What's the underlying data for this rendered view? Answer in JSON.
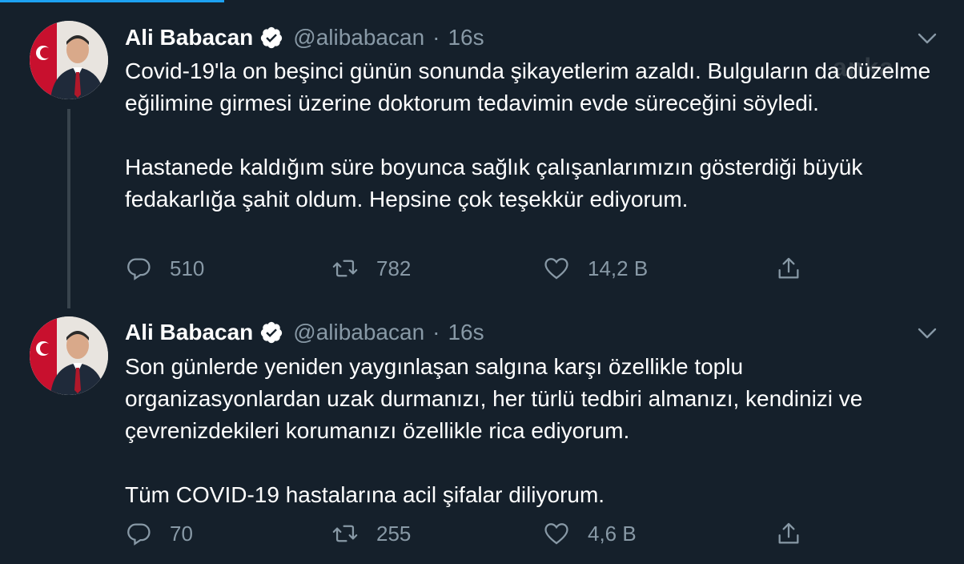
{
  "watermark": "anka",
  "colors": {
    "background": "#15202b",
    "text_primary": "#ffffff",
    "text_secondary": "#8899a6",
    "accent": "#1da1f2",
    "verified": "#1da1f2"
  },
  "tweets": [
    {
      "author_name": "Ali Babacan",
      "handle": "@alibabacan",
      "separator": "·",
      "time": "16s",
      "paragraphs": [
        "Covid-19'la on beşinci günün sonunda şikayetlerim azaldı.  Bulguların da düzelme eğilimine girmesi üzerine doktorum tedavimin evde süreceğini söyledi.",
        "Hastanede kaldığım süre boyunca sağlık çalışanlarımızın gösterdiği büyük fedakarlığa şahit oldum. Hepsine çok teşekkür ediyorum."
      ],
      "replies": "510",
      "retweets": "782",
      "likes": "14,2 B"
    },
    {
      "author_name": "Ali Babacan",
      "handle": "@alibabacan",
      "separator": "·",
      "time": "16s",
      "paragraphs": [
        "Son günlerde yeniden yaygınlaşan salgına karşı özellikle toplu organizasyonlardan uzak durmanızı, her türlü tedbiri almanızı, kendinizi ve çevrenizdekileri korumanızı özellikle rica ediyorum.",
        "Tüm COVID-19 hastalarına acil şifalar diliyorum."
      ],
      "replies": "70",
      "retweets": "255",
      "likes": "4,6 B"
    }
  ],
  "icons": {
    "reply": "reply-icon",
    "retweet": "retweet-icon",
    "like": "heart-icon",
    "share": "share-icon",
    "more": "chevron-down-icon",
    "verified": "verified-badge-icon"
  }
}
